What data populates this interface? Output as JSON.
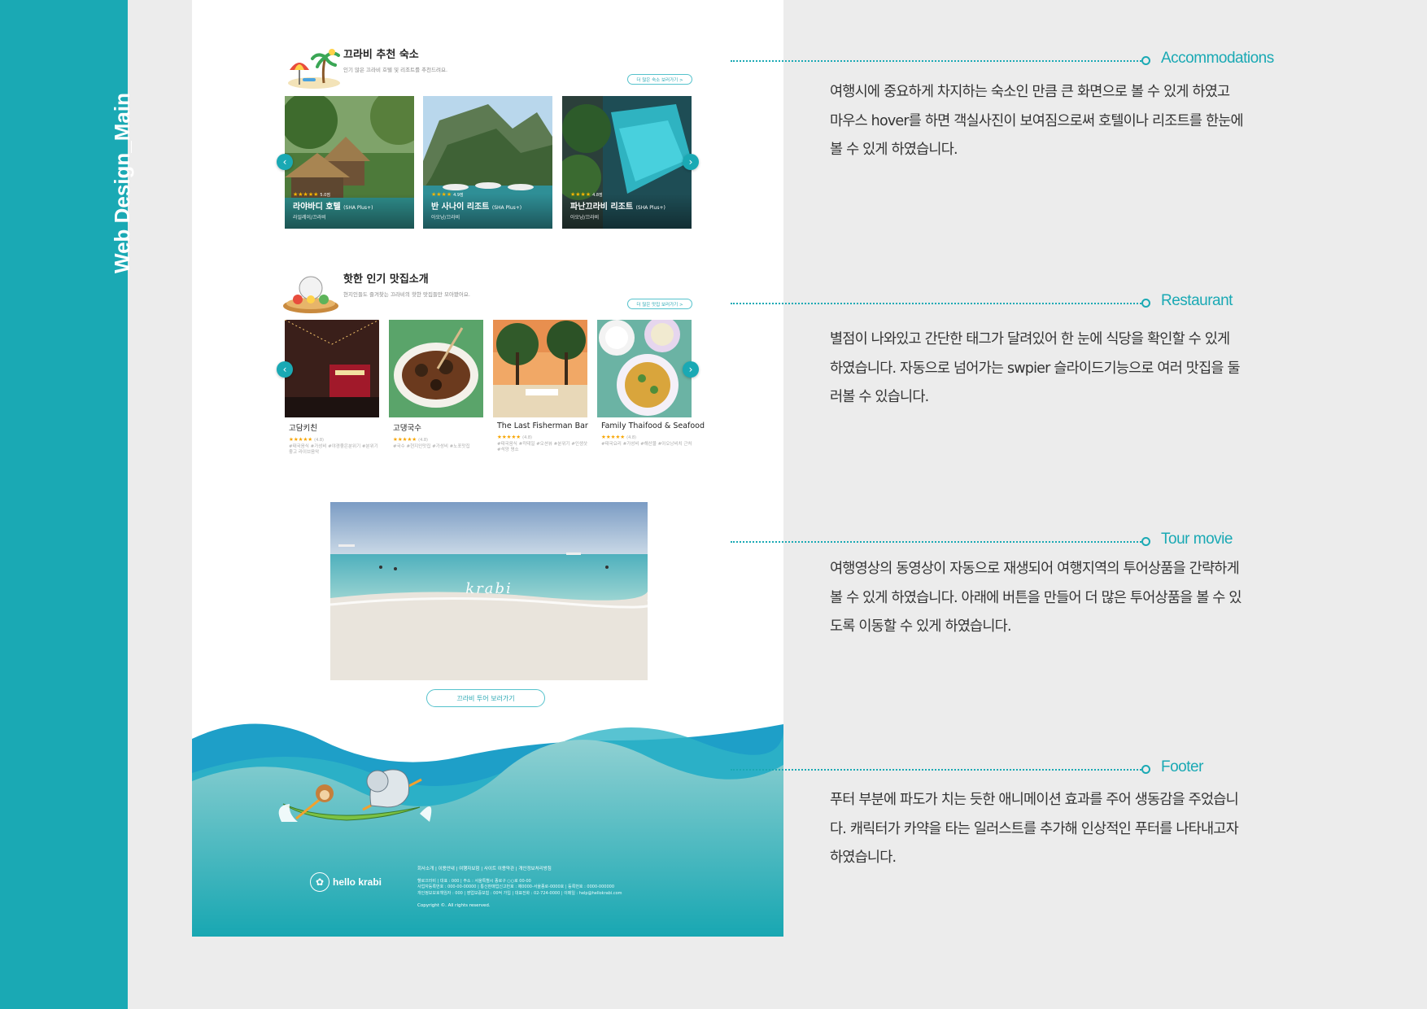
{
  "sidebar": {
    "title": "Web Design_Main"
  },
  "accommodations": {
    "title": "끄라비 추천 숙소",
    "subtitle": "인기 많은 끄라비 호텔 및 리조트를 추천드려요.",
    "more_label": "더 많은 숙소 보러가기 >",
    "cards": [
      {
        "stars": "★★★★★",
        "score": "5.0점",
        "name": "라야바디 호텔",
        "badge": "(SHA Plus+)",
        "location": "라일레이/끄라비"
      },
      {
        "stars": "★★★★",
        "score": "4.9점",
        "name": "반 사나이 리조트",
        "badge": "(SHA Plus+)",
        "location": "아오낭/끄라비"
      },
      {
        "stars": "★★★★",
        "score": "4.8점",
        "name": "파난끄라비 리조트",
        "badge": "(SHA Plus+)",
        "location": "아오낭/끄라비"
      }
    ]
  },
  "restaurants": {
    "title": "핫한 인기 맛집소개",
    "subtitle": "현지인들도 즐겨찾는 끄라비의 핫한 맛집들만 모아봤어요.",
    "more_label": "더 많은 맛집 보러가기 >",
    "items": [
      {
        "name": "고담키친",
        "stars": "★★★★★",
        "score": "(4.8)",
        "tags": "#태국음식 #가성비 #야경좋은분위기 #분위기 좋고 라이브음악"
      },
      {
        "name": "고댕국수",
        "stars": "★★★★★",
        "score": "(4.8)",
        "tags": "#국수 #현지인맛집 #가성비 #노포맛집"
      },
      {
        "name": "The Last Fisherman Bar",
        "stars": "★★★★★",
        "score": "(4.8)",
        "tags": "#태국음식 #칵테일 #오션뷰 #분위기 #인생샷 #석양 명소"
      },
      {
        "name": "Family Thaifood & Seafood",
        "stars": "★★★★★",
        "score": "(4.8)",
        "tags": "#태국요리 #가성비 #해산물 #아오낭비치 근처"
      }
    ]
  },
  "tour_video": {
    "overlay_text": "krabi",
    "button_label": "끄라비 투어 보러가기"
  },
  "footer": {
    "logo_text": "hello krabi",
    "links": "회사소개 | 이용안내 | 여행자보험 | 사이트 이용약관 | 개인정보처리방침",
    "info_line1": "헬로끄라비 | 대표 : 000 | 주소 : 서울특별시 종로구 ○○로 00-00",
    "info_line2": "사업자등록번호 : 000-00-00000 | 통신판매업신고번호 : 제0000-서울종로-0000호 | 등록번호 : 0000-000000",
    "info_line3": "개인정보보호책임자 : 000 | 영업보증보험 : 00억 가입 | 대표전화 : 02-724-0000 | 이메일 : help@hellokrabi.com",
    "copyright": "Copyright ©. All rights reserved."
  },
  "annotations": [
    {
      "title": "Accommodations",
      "lines": [
        "여행시에 중요하게 차지하는 숙소인 만큼 큰 화면으로 볼 수 있게 하였고",
        "마우스 hover를 하면 객실사진이 보여짐으로써 호텔이나 리조트를 한눈에",
        "볼 수 있게 하였습니다."
      ]
    },
    {
      "title": "Restaurant",
      "lines": [
        "별점이 나와있고 간단한 태그가 달려있어 한 눈에 식당을 확인할 수 있게",
        "하였습니다. 자동으로 넘어가는 swpier 슬라이드기능으로 여러 맛집을 둘",
        "러볼 수 있습니다."
      ]
    },
    {
      "title": "Tour movie",
      "lines": [
        "여행영상의 동영상이 자동으로 재생되어 여행지역의 투어상품을 간략하게",
        "볼 수 있게 하였습니다. 아래에 버튼을 만들어 더 많은 투어상품을 볼 수 있",
        "도록 이동할 수 있게 하였습니다."
      ]
    },
    {
      "title": "Footer",
      "lines": [
        "푸터 부분에 파도가 치는 듯한 애니메이션 효과를 주어 생동감을 주었습니",
        "다. 캐릭터가 카약을 타는 일러스트를 추가해 인상적인 푸터를 나타내고자",
        "하였습니다."
      ]
    }
  ],
  "colors": {
    "accent": "#1aa9b4",
    "background": "#ececec",
    "star": "#f7b500"
  }
}
